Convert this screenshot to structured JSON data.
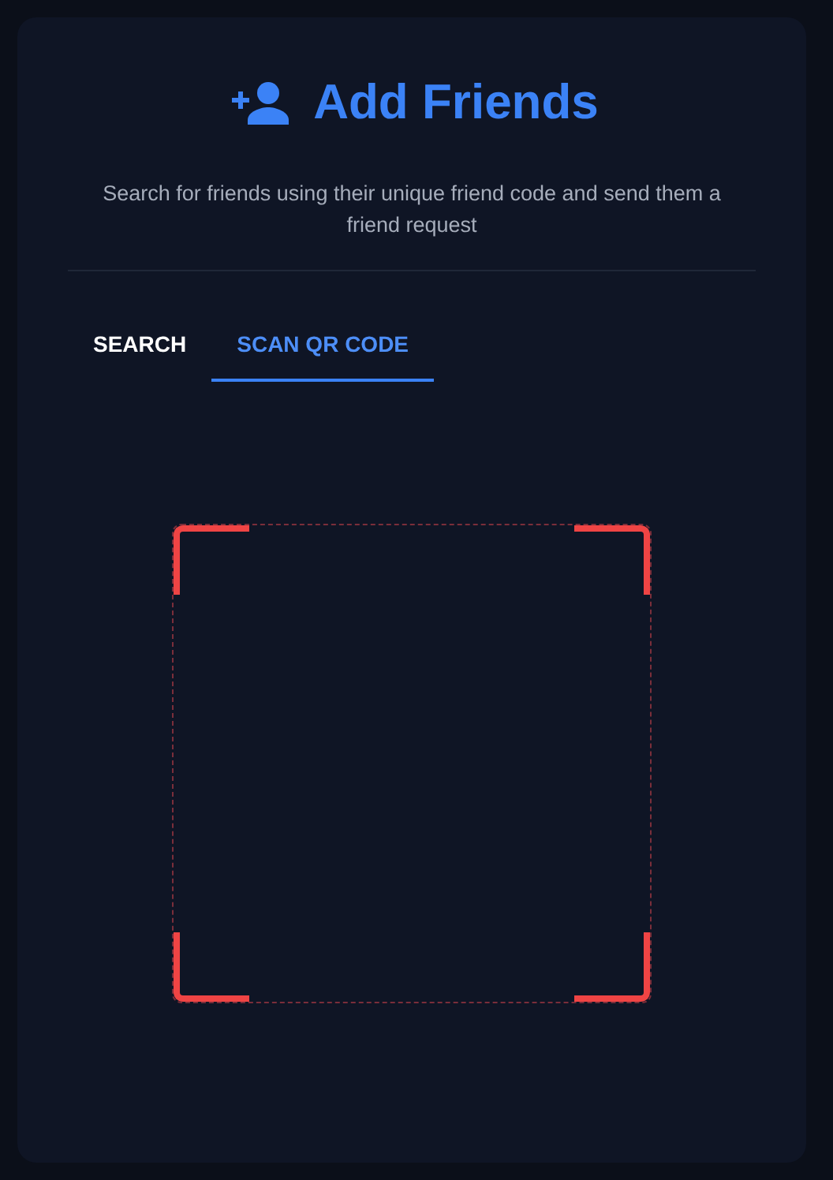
{
  "header": {
    "title": "Add Friends",
    "description": "Search for friends using their unique friend code and send them a friend request"
  },
  "tabs": [
    {
      "label": "SEARCH",
      "selected": false
    },
    {
      "label": "SCAN QR CODE",
      "selected": true
    }
  ]
}
